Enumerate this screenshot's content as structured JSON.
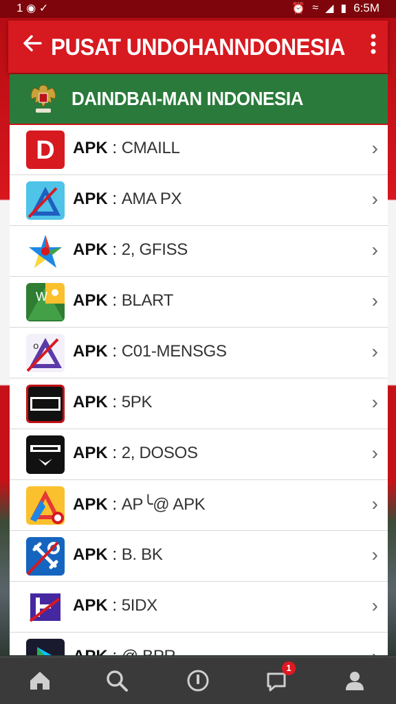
{
  "status_bar": {
    "left": "1",
    "time": "6:5M"
  },
  "app_bar": {
    "title": "PUSAT UNDOHANNDONESIA"
  },
  "sub_header": {
    "title": "DAINDBAI-MAN INDONESIA"
  },
  "list": {
    "items": [
      {
        "prefix": "APK",
        "sep": " : ",
        "name": "CMAILL",
        "icon": "d-letter-icon"
      },
      {
        "prefix": "APK",
        "sep": " : ",
        "name": "AMA PX",
        "icon": "blue-triangle-icon"
      },
      {
        "prefix": "APK",
        "sep": " : ",
        "name": "2, GFISS",
        "icon": "star-pinwheel-icon"
      },
      {
        "prefix": "APK",
        "sep": " : ",
        "name": "BLART",
        "icon": "green-yellow-drive-icon"
      },
      {
        "prefix": "APK",
        "sep": " : ",
        "name": "C01-MENSGS",
        "icon": "purple-doc-icon"
      },
      {
        "prefix": "APK",
        "sep": " : ",
        "name": "5PK",
        "icon": "lltam-icon"
      },
      {
        "prefix": "APK",
        "sep": " : ",
        "name": "2, DOSOS",
        "icon": "maipan-icon"
      },
      {
        "prefix": "APK",
        "sep": " : ",
        "name": "AP╰@ APK",
        "icon": "yellow-drive-icon"
      },
      {
        "prefix": "APK",
        "sep": " : ",
        "name": "B. BK",
        "icon": "blue-tools-icon"
      },
      {
        "prefix": "APK",
        "sep": " : ",
        "name": "5IDX",
        "icon": "purple-h-icon"
      },
      {
        "prefix": "APK",
        "sep": " : ",
        "name": "@ BPR",
        "icon": "play-store-icon"
      }
    ]
  },
  "bottom_nav": {
    "items": [
      "home-icon",
      "search-icon",
      "info-icon",
      "chat-icon",
      "profile-icon"
    ],
    "chat_badge": "1"
  },
  "colors": {
    "red": "#d71920",
    "green": "#2a7a3b",
    "nav": "#3a3a3a"
  }
}
